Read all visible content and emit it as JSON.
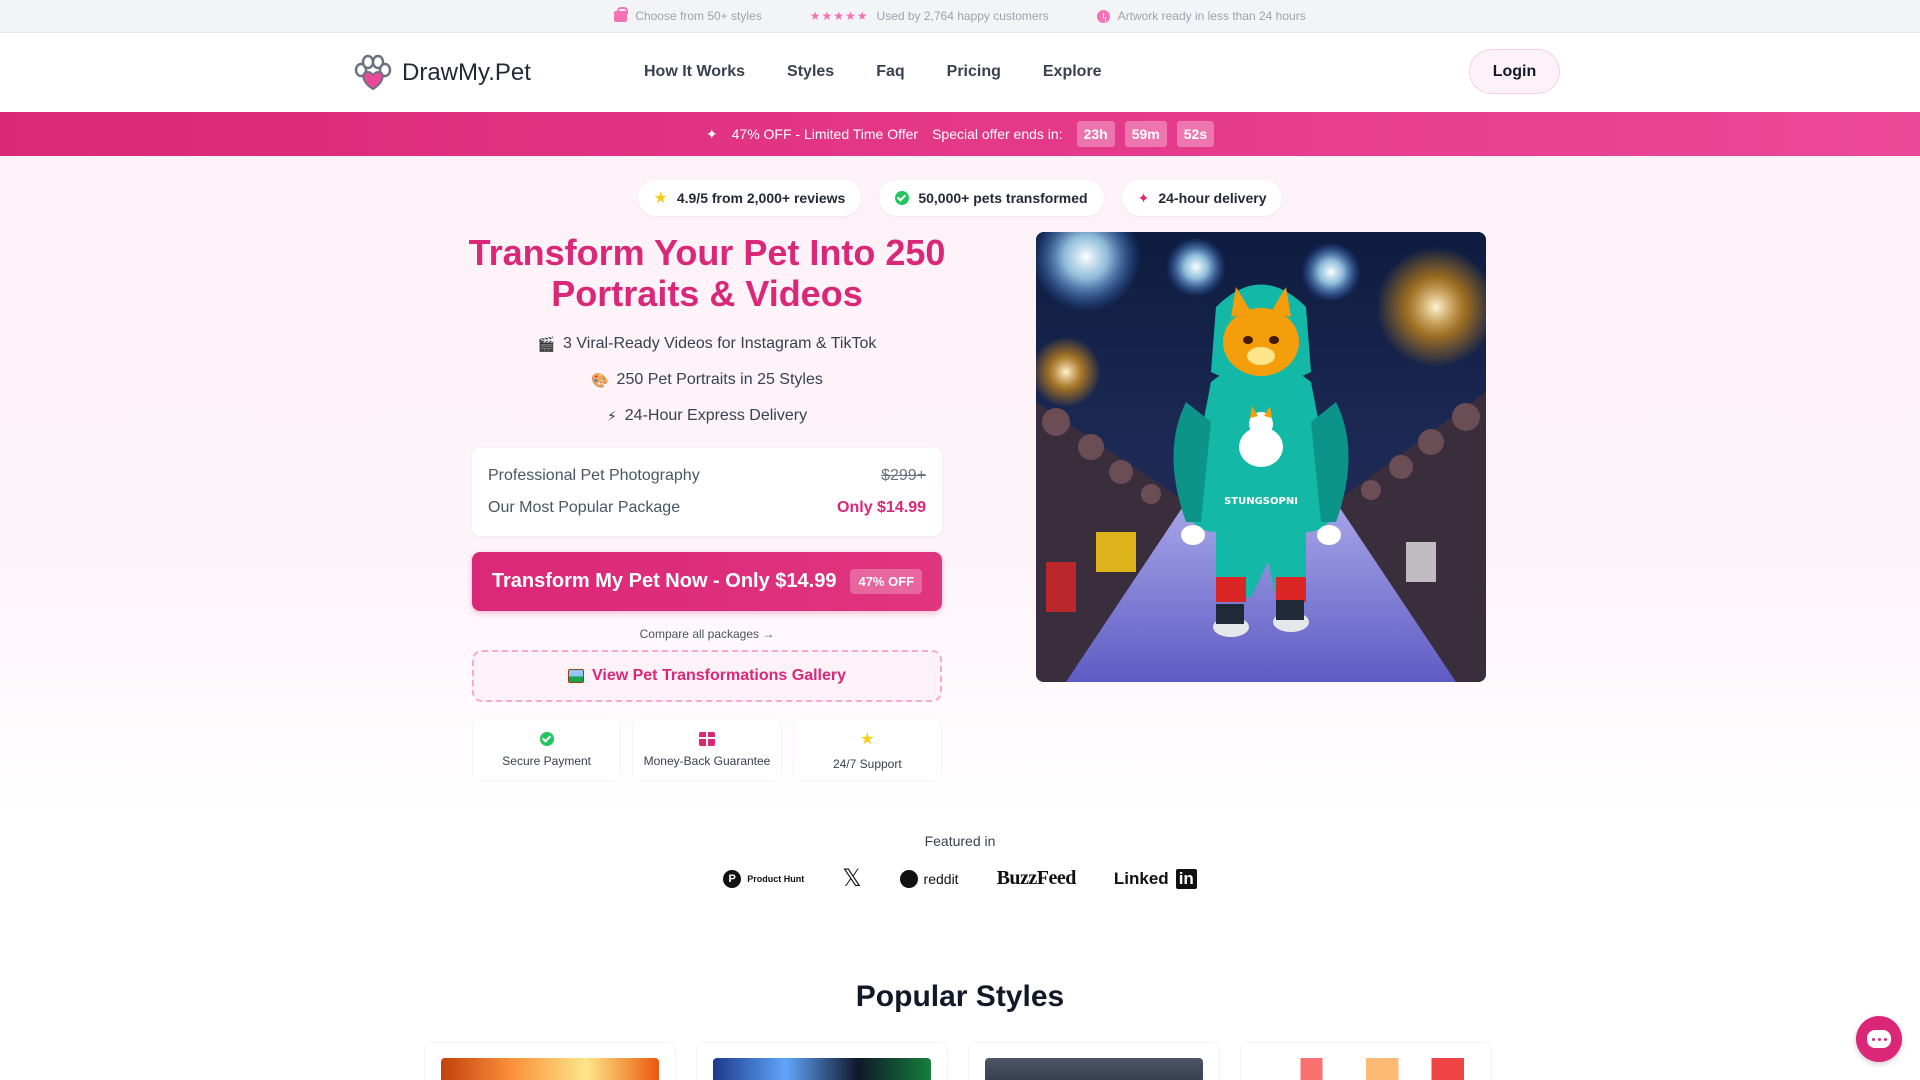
{
  "topbar": {
    "item1": "Choose from 50+ styles",
    "stars": "★★★★★",
    "item2": "Used by 2,764 happy customers",
    "item3": "Artwork ready in less than 24 hours"
  },
  "nav": {
    "logo": "DrawMy.Pet",
    "menu": [
      "How It Works",
      "Styles",
      "Faq",
      "Pricing",
      "Explore"
    ],
    "login": "Login"
  },
  "promo": {
    "offer": "47% OFF - Limited Time Offer",
    "ends_label": "Special offer ends in:",
    "timer": [
      "23h",
      "59m",
      "52s"
    ]
  },
  "chips": [
    "4.9/5 from 2,000+ reviews",
    "50,000+ pets transformed",
    "24-hour delivery"
  ],
  "hero": {
    "title": "Transform Your Pet Into 250 Portraits & Videos",
    "features": [
      {
        "icon": "🎬",
        "text": "3 Viral-Ready Videos for Instagram & TikTok"
      },
      {
        "icon": "🎨",
        "text": "250 Pet Portraits in 25 Styles"
      },
      {
        "icon": "⚡",
        "text": "24-Hour Express Delivery"
      }
    ],
    "price_rows": [
      {
        "label": "Professional Pet Photography",
        "value": "$299+"
      },
      {
        "label": "Our Most Popular Package",
        "value": "Only $14.99"
      }
    ],
    "cta": "Transform My Pet Now - Only $14.99",
    "cta_badge": "47% OFF",
    "compare": "Compare all packages →",
    "gallery": "View Pet Transformations Gallery",
    "trust": [
      "Secure Payment",
      "Money-Back Guarantee",
      "24/7 Support"
    ],
    "image_caption": "STUNGSOPNI"
  },
  "featured": {
    "label": "Featured in",
    "logos": {
      "producthunt": "Product Hunt",
      "x": "𝕏",
      "reddit": "reddit",
      "buzzfeed": "BuzzFeed",
      "linkedin": "Linked",
      "linkedin_in": "in"
    }
  },
  "popular": {
    "title": "Popular Styles"
  },
  "colors": {
    "accent": "#db2777",
    "accent_light": "#fdf2f8"
  }
}
